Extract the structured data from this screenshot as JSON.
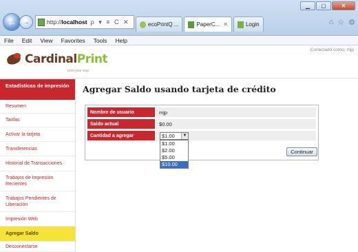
{
  "browser": {
    "url_prefix": "http://",
    "url_host": "localhost",
    "addr_tools": "ρ ▾ ≡ C ✕",
    "tabs": [
      {
        "label": "ecoPrintQ ..."
      },
      {
        "label": "PaperC..."
      },
      {
        "label": "Login"
      }
    ],
    "tab_close": "✕"
  },
  "menu": [
    "File",
    "Edit",
    "View",
    "Favorites",
    "Tools",
    "Help"
  ],
  "header": {
    "logo_a": "Cardinal",
    "logo_b": "Print",
    "logo_sub": "print your way",
    "connected": "Conectado como: mjp"
  },
  "sidebar": {
    "heading": "Estadísticas de impresión",
    "items": [
      {
        "label": "Resumen"
      },
      {
        "label": "Tarifas"
      },
      {
        "label": "Activar la tarjeta"
      },
      {
        "label": "Transferencias"
      },
      {
        "label": "Historial de Transacciones"
      },
      {
        "label": "Trabajos de Impresión Recientes"
      },
      {
        "label": "Trabajos Pendientes de Liberación"
      },
      {
        "label": "Impresión Web"
      },
      {
        "label": "Agregar Saldo"
      },
      {
        "label": "Desconectarse"
      }
    ]
  },
  "main": {
    "title": "Agregar Saldo usando tarjeta de crédito",
    "fields": [
      {
        "label": "Nombre de usuario",
        "value": "mjp"
      },
      {
        "label": "Saldo actual",
        "value": "$0.00"
      },
      {
        "label": "Cantidad a agregar",
        "value": ""
      }
    ],
    "select": {
      "selected": "$1.00",
      "options": [
        "$1.00",
        "$2.00",
        "$5.00",
        "$10.00"
      ]
    },
    "continue_label": "Continuar"
  }
}
